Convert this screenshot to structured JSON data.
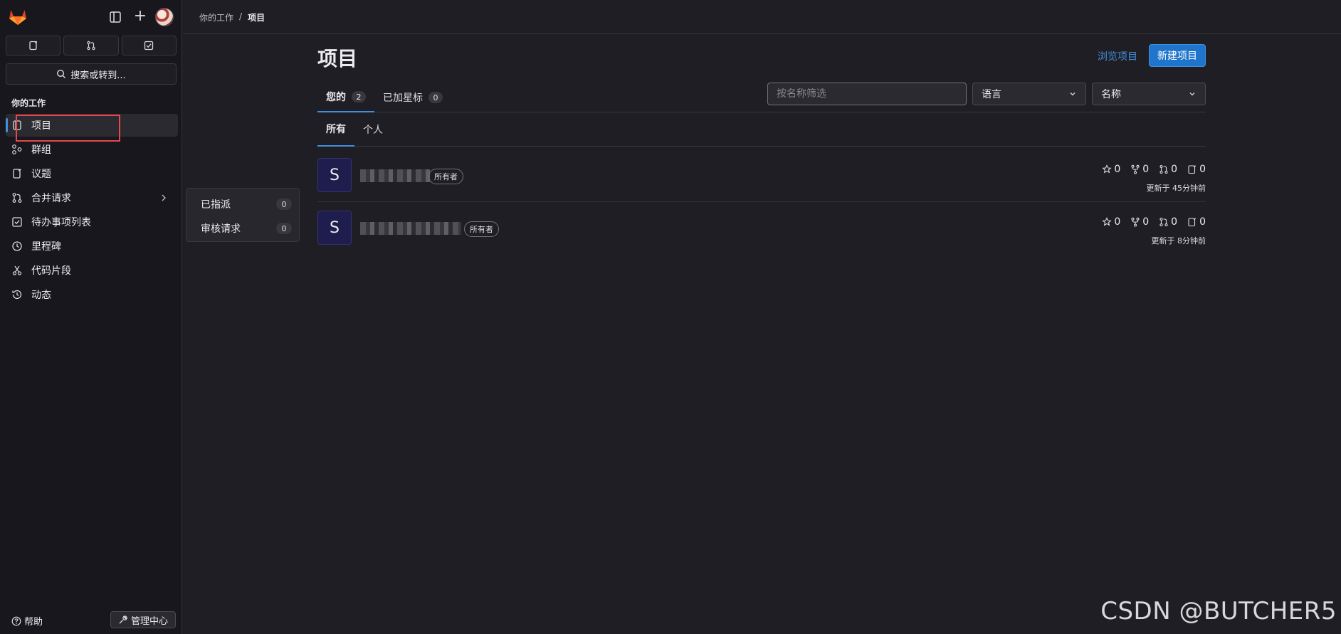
{
  "sidebar": {
    "search_label": "搜索或转到...",
    "section_title": "你的工作",
    "items": [
      {
        "label": "项目",
        "icon": "project-icon"
      },
      {
        "label": "群组",
        "icon": "group-icon"
      },
      {
        "label": "议题",
        "icon": "issues-icon"
      },
      {
        "label": "合并请求",
        "icon": "merge-request-icon"
      },
      {
        "label": "待办事项列表",
        "icon": "todo-icon"
      },
      {
        "label": "里程碑",
        "icon": "milestone-icon"
      },
      {
        "label": "代码片段",
        "icon": "snippet-icon"
      },
      {
        "label": "动态",
        "icon": "history-icon"
      }
    ],
    "help_label": "帮助",
    "admin_label": "管理中心"
  },
  "breadcrumb": {
    "parent": "你的工作",
    "sep": "/",
    "current": "项目"
  },
  "flyout": {
    "items": [
      {
        "label": "已指派",
        "count": "0"
      },
      {
        "label": "审核请求",
        "count": "0"
      }
    ]
  },
  "main": {
    "title": "项目",
    "explore_label": "浏览项目",
    "new_project_label": "新建项目",
    "tabs": [
      {
        "label": "您的",
        "count": "2"
      },
      {
        "label": "已加星标",
        "count": "0"
      }
    ],
    "filter_placeholder": "按名称筛选",
    "language_label": "语言",
    "sort_label": "名称",
    "subtabs": [
      "所有",
      "个人"
    ],
    "projects": [
      {
        "avatar": "S",
        "badge": "所有者",
        "stars": "0",
        "forks": "0",
        "mrs": "0",
        "issues": "0",
        "updated": "更新于 45分钟前"
      },
      {
        "avatar": "S",
        "badge": "所有者",
        "stars": "0",
        "forks": "0",
        "mrs": "0",
        "issues": "0",
        "updated": "更新于 8分钟前"
      }
    ]
  },
  "watermark": "CSDN @BUTCHER5",
  "colors": {
    "accent": "#428fdc",
    "primary_button": "#1f75cb",
    "highlight": "#e5484d",
    "logo": "#e24329"
  }
}
